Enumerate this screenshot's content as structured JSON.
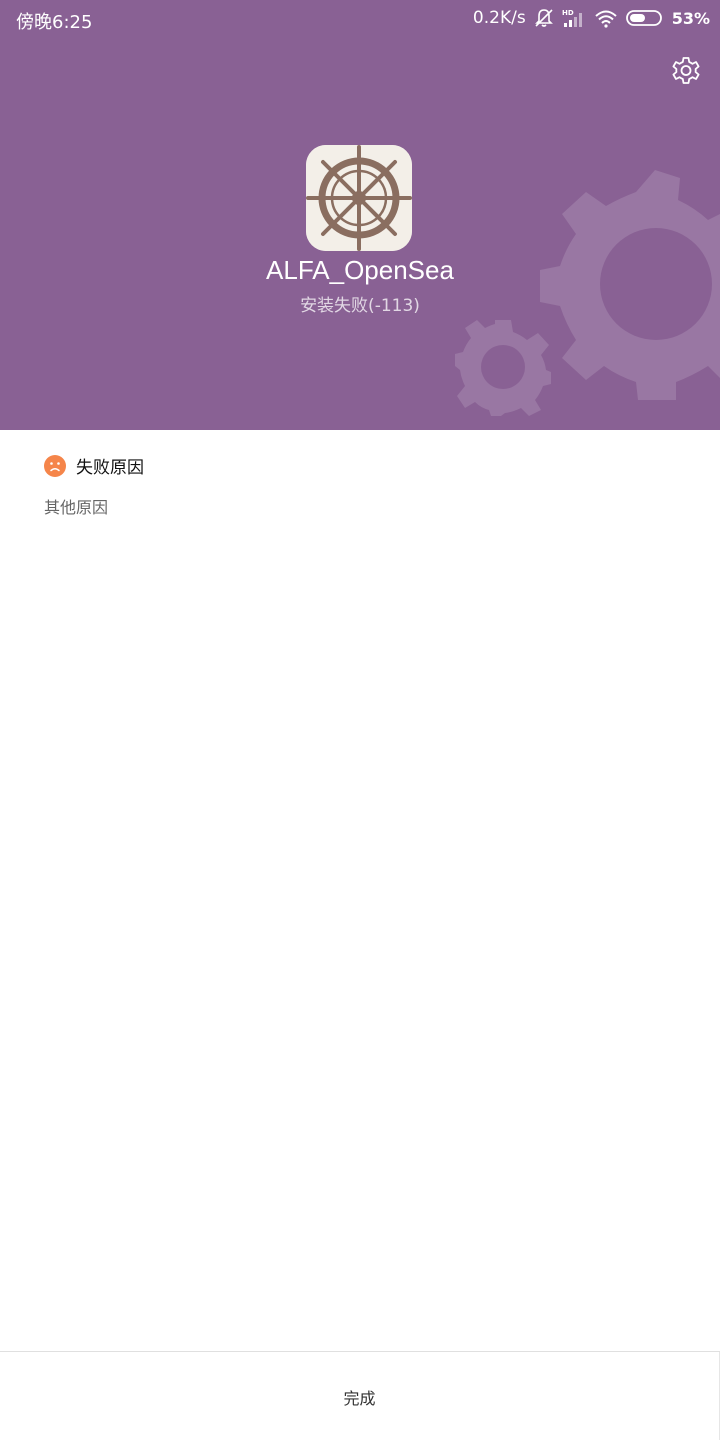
{
  "status_bar": {
    "time": "傍晚6:25",
    "net_speed": "0.2K/s",
    "battery_percent": "53%",
    "battery_level": 0.53,
    "icons": [
      "mute-bell-icon",
      "hd-signal-icon",
      "wifi-icon",
      "battery-icon"
    ]
  },
  "header": {
    "background_color": "#896194",
    "settings_icon": "gear-icon",
    "app_icon": "ship-wheel-icon",
    "app_name": "ALFA_OpenSea",
    "install_status": "安装失败(-113)"
  },
  "failure": {
    "icon": "sad-face-icon",
    "icon_color": "#f5854a",
    "title": "失败原因",
    "detail": "其他原因"
  },
  "footer": {
    "done_label": "完成"
  }
}
